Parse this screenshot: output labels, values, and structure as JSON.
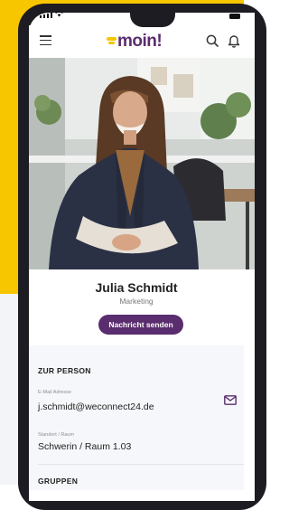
{
  "app": {
    "logo_text": "moin!",
    "brand_color": "#5a2d6e",
    "accent_color": "#f7c600"
  },
  "header": {
    "menu_icon": "hamburger-menu-icon",
    "search_icon": "search-icon",
    "notification_icon": "bell-icon"
  },
  "profile": {
    "name": "Julia Schmidt",
    "department": "Marketing",
    "message_button": "Nachricht senden"
  },
  "about": {
    "section_title": "ZUR PERSON",
    "email_label": "E-Mail Adresse",
    "email_value": "j.schmidt@weconnect24.de",
    "location_label": "Standort / Raum",
    "location_value": "Schwerin / Raum 1.03"
  },
  "groups": {
    "section_title": "GRUPPEN"
  }
}
